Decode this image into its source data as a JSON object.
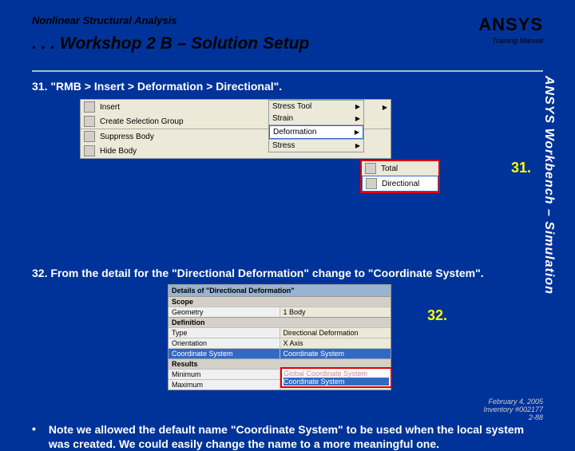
{
  "header": {
    "subtitle": "Nonlinear Structural Analysis",
    "title": ". . . Workshop 2 B – Solution Setup",
    "logo": "ANSYS",
    "logo_sub": "Training Manual"
  },
  "sidebar_text": "ANSYS Workbench – Simulation",
  "step31": "31. \"RMB > Insert > Deformation > Directional\".",
  "menu": {
    "items": [
      {
        "label": "Insert",
        "arrow": true
      },
      {
        "label": "Create Selection Group"
      },
      {
        "label": "Suppress Body"
      },
      {
        "label": "Hide Body"
      }
    ],
    "sub1": [
      {
        "label": "Stress Tool",
        "arrow": true
      },
      {
        "label": "Strain",
        "arrow": true
      },
      {
        "sep": true
      },
      {
        "label": "Deformation",
        "arrow": true,
        "hl": true
      },
      {
        "sep": true
      },
      {
        "label": "Stress",
        "arrow": true
      }
    ],
    "sub2": [
      {
        "label": "Total"
      },
      {
        "label": "Directional",
        "hl": true
      }
    ]
  },
  "callout31": "31.",
  "step32": "32. From the detail for the \"Directional Deformation\" change to \"Coordinate System\".",
  "details": {
    "title": "Details of \"Directional Deformation\"",
    "groups": [
      {
        "head": "Scope",
        "rows": [
          [
            "Geometry",
            "1 Body"
          ]
        ]
      },
      {
        "head": "Definition",
        "rows": [
          [
            "Type",
            "Directional Deformation"
          ],
          [
            "Orientation",
            "X Axis"
          ],
          [
            "Coordinate System",
            "Coordinate System"
          ]
        ]
      },
      {
        "head": "Results",
        "rows": [
          [
            "Minimum",
            ""
          ],
          [
            "Maximum",
            ""
          ]
        ]
      }
    ],
    "dropdown": [
      "Global Coordinate System",
      "Coordinate System"
    ]
  },
  "callout32": "32.",
  "note": "Note we allowed the default name \"Coordinate System\" to be used when the local system was created. We could easily change the name to a more meaningful one.",
  "footer": {
    "date": "February 4, 2005",
    "inv": "Inventory #002177",
    "page": "2-88"
  }
}
